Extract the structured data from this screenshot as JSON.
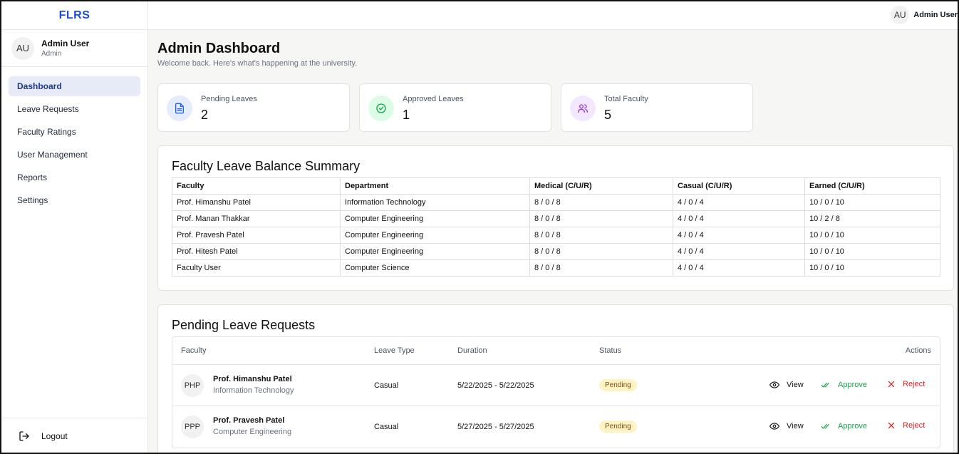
{
  "brand": "FLRS",
  "sidebar": {
    "user": {
      "initials": "AU",
      "name": "Admin User",
      "role": "Admin"
    },
    "items": [
      {
        "label": "Dashboard"
      },
      {
        "label": "Leave Requests"
      },
      {
        "label": "Faculty Ratings"
      },
      {
        "label": "User Management"
      },
      {
        "label": "Reports"
      },
      {
        "label": "Settings"
      }
    ],
    "logout": "Logout"
  },
  "topbar": {
    "initials": "AU",
    "name": "Admin User"
  },
  "page": {
    "title": "Admin Dashboard",
    "subtitle": "Welcome back. Here's what's happening at the university."
  },
  "stats": [
    {
      "label": "Pending Leaves",
      "value": "2",
      "icon": "document-icon"
    },
    {
      "label": "Approved Leaves",
      "value": "1",
      "icon": "check-circle-icon"
    },
    {
      "label": "Total Faculty",
      "value": "5",
      "icon": "users-icon"
    }
  ],
  "balance": {
    "title": "Faculty Leave Balance Summary",
    "headers": [
      "Faculty",
      "Department",
      "Medical (C/U/R)",
      "Casual (C/U/R)",
      "Earned (C/U/R)"
    ],
    "rows": [
      [
        "Prof. Himanshu Patel",
        "Information Technology",
        "8 / 0 / 8",
        "4 / 0 / 4",
        "10 / 0 / 10"
      ],
      [
        "Prof. Manan Thakkar",
        "Computer Engineering",
        "8 / 0 / 8",
        "4 / 0 / 4",
        "10 / 2 / 8"
      ],
      [
        "Prof. Pravesh Patel",
        "Computer Engineering",
        "8 / 0 / 8",
        "4 / 0 / 4",
        "10 / 0 / 10"
      ],
      [
        "Prof. Hitesh Patel",
        "Computer Engineering",
        "8 / 0 / 8",
        "4 / 0 / 4",
        "10 / 0 / 10"
      ],
      [
        "Faculty User",
        "Computer Science",
        "8 / 0 / 8",
        "4 / 0 / 4",
        "10 / 0 / 10"
      ]
    ]
  },
  "pending": {
    "title": "Pending Leave Requests",
    "headers": {
      "faculty": "Faculty",
      "type": "Leave Type",
      "duration": "Duration",
      "status": "Status",
      "actions": "Actions"
    },
    "rows": [
      {
        "initials": "PHP",
        "name": "Prof. Himanshu Patel",
        "dept": "Information Technology",
        "type": "Casual",
        "duration": "5/22/2025 - 5/22/2025",
        "status": "Pending"
      },
      {
        "initials": "PPP",
        "name": "Prof. Pravesh Patel",
        "dept": "Computer Engineering",
        "type": "Casual",
        "duration": "5/27/2025 - 5/27/2025",
        "status": "Pending"
      }
    ],
    "actions": {
      "view": "View",
      "approve": "Approve",
      "reject": "Reject"
    }
  },
  "colors": {
    "accent": "#1d4ed8",
    "approve": "#16a34a",
    "reject": "#dc2626",
    "pending_bg": "#fdf3c4"
  }
}
